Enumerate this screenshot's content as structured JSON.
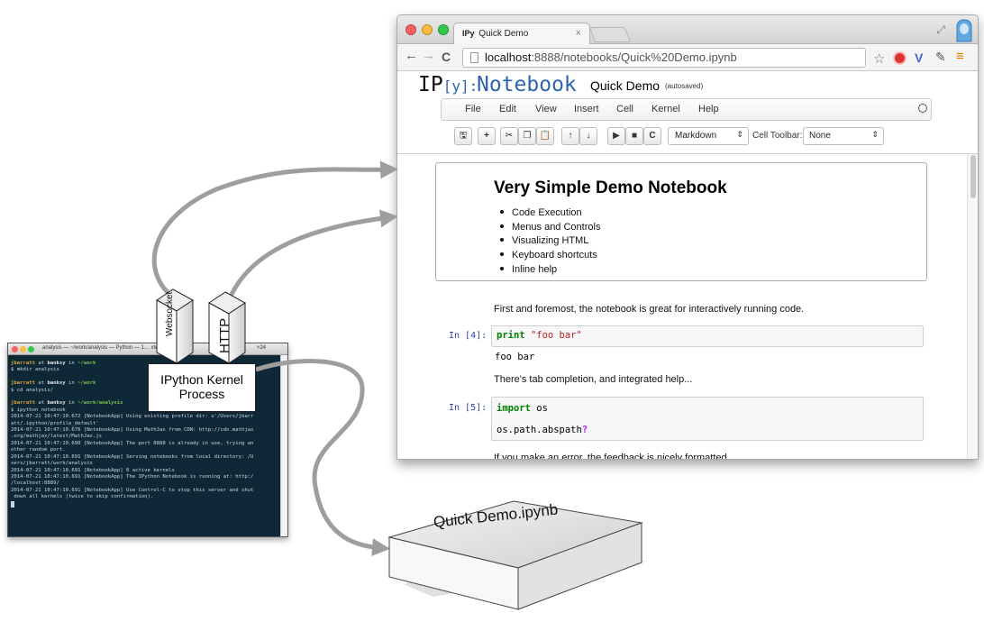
{
  "browser": {
    "tab_badge": "IPy",
    "tab_title": "Quick Demo",
    "tab_close": "×",
    "url_host": "localhost",
    "url_path": ":8888/notebooks/Quick%20Demo.ipynb",
    "nav_back": "←",
    "nav_forward": "→",
    "nav_reload": "C",
    "star": "☆",
    "ext_v": "V",
    "ext_wrench": "✎",
    "menu_glyph": "≡"
  },
  "notebook": {
    "logo_ip": "IP",
    "logo_y": "[y]:",
    "logo_word": "Notebook",
    "name": "Quick Demo",
    "autosave": "(autosaved)",
    "menus": [
      "File",
      "Edit",
      "View",
      "Insert",
      "Cell",
      "Kernel",
      "Help"
    ],
    "cell_type": "Markdown",
    "cell_toolbar_label": "Cell Toolbar:",
    "cell_toolbar_value": "None",
    "select_arrow": "⇕",
    "md_title": "Very Simple Demo Notebook",
    "md_items": [
      "Code Execution",
      "Menus and Controls",
      "Visualizing HTML",
      "Keyboard shortcuts",
      "Inline help"
    ],
    "text1": "First and foremost, the notebook is great for interactively running code.",
    "prompt1": "In [4]:",
    "code1_kw": "print",
    "code1_str": "\"foo bar\"",
    "output1": "foo bar",
    "text2": "There's tab completion, and integrated help...",
    "prompt2": "In [5]:",
    "code2_kw": "import",
    "code2_rest": " os",
    "code2_line2": "os.path.abspath",
    "code2_q": "?",
    "text3": "If you make an error, the feedback is nicely formatted..."
  },
  "toolbar_buttons": [
    {
      "icon": "save-icon",
      "glyph": "🖫"
    },
    {
      "icon": "insert-cell-icon",
      "glyph": "+"
    },
    {
      "icon": "cut-icon",
      "glyph": "✂"
    },
    {
      "icon": "copy-icon",
      "glyph": "❐"
    },
    {
      "icon": "paste-icon",
      "glyph": "📋"
    },
    {
      "icon": "move-up-icon",
      "glyph": "↑"
    },
    {
      "icon": "move-down-icon",
      "glyph": "↓"
    },
    {
      "icon": "run-icon",
      "glyph": "▶"
    },
    {
      "icon": "stop-icon",
      "glyph": "■"
    },
    {
      "icon": "restart-icon",
      "glyph": "C"
    }
  ],
  "terminal": {
    "title": "analysis — ~/work/analysis — Python — 1… xterm-256color",
    "dims": "×24",
    "lines": [
      {
        "user": "jbarratt",
        "at": " at ",
        "host": "banksy",
        "in": " in ",
        "dir": "~/work"
      },
      {
        "text": "$ mkdir analysis"
      },
      {
        "text": ""
      },
      {
        "user": "jbarratt",
        "at": " at ",
        "host": "banksy",
        "in": " in ",
        "dir": "~/work"
      },
      {
        "text": "$ cd analysis/"
      },
      {
        "text": ""
      },
      {
        "user": "jbarratt",
        "at": " at ",
        "host": "banksy",
        "in": " in ",
        "dir": "~/work/analysis"
      },
      {
        "text": "$ ipython notebook"
      },
      {
        "text": "2014-07-21 10:47:10.672 [NotebookApp] Using existing profile dir: u'/Users/jbarr"
      },
      {
        "text": "att/.ipython/profile_default'"
      },
      {
        "text": "2014-07-21 10:47:10.676 [NotebookApp] Using MathJax from CDN: http://cdn.mathjax"
      },
      {
        "text": ".org/mathjax/latest/MathJax.js"
      },
      {
        "text": "2014-07-21 10:47:10.690 [NotebookApp] The port 8888 is already in use, trying an"
      },
      {
        "text": "other random port."
      },
      {
        "text": "2014-07-21 10:47:10.691 [NotebookApp] Serving notebooks from local directory: /U"
      },
      {
        "text": "sers/jbarratt/work/analysis"
      },
      {
        "text": "2014-07-21 10:47:10.691 [NotebookApp] 0 active kernels"
      },
      {
        "text": "2014-07-21 10:47:10.691 [NotebookApp] The IPython Notebook is running at: http:/"
      },
      {
        "text": "/localhost:8889/"
      },
      {
        "text": "2014-07-21 10:47:10.691 [NotebookApp] Use Control-C to stop this server and shut"
      },
      {
        "text": " down all kernels (twice to skip confirmation)."
      }
    ]
  },
  "diagram": {
    "websocket_label": "Websocket",
    "http_label": "HTTP",
    "kernel_line1": "IPython Kernel",
    "kernel_line2": "Process",
    "file_label": "Quick Demo.ipynb",
    "arrow_color": "#9e9e9e"
  }
}
